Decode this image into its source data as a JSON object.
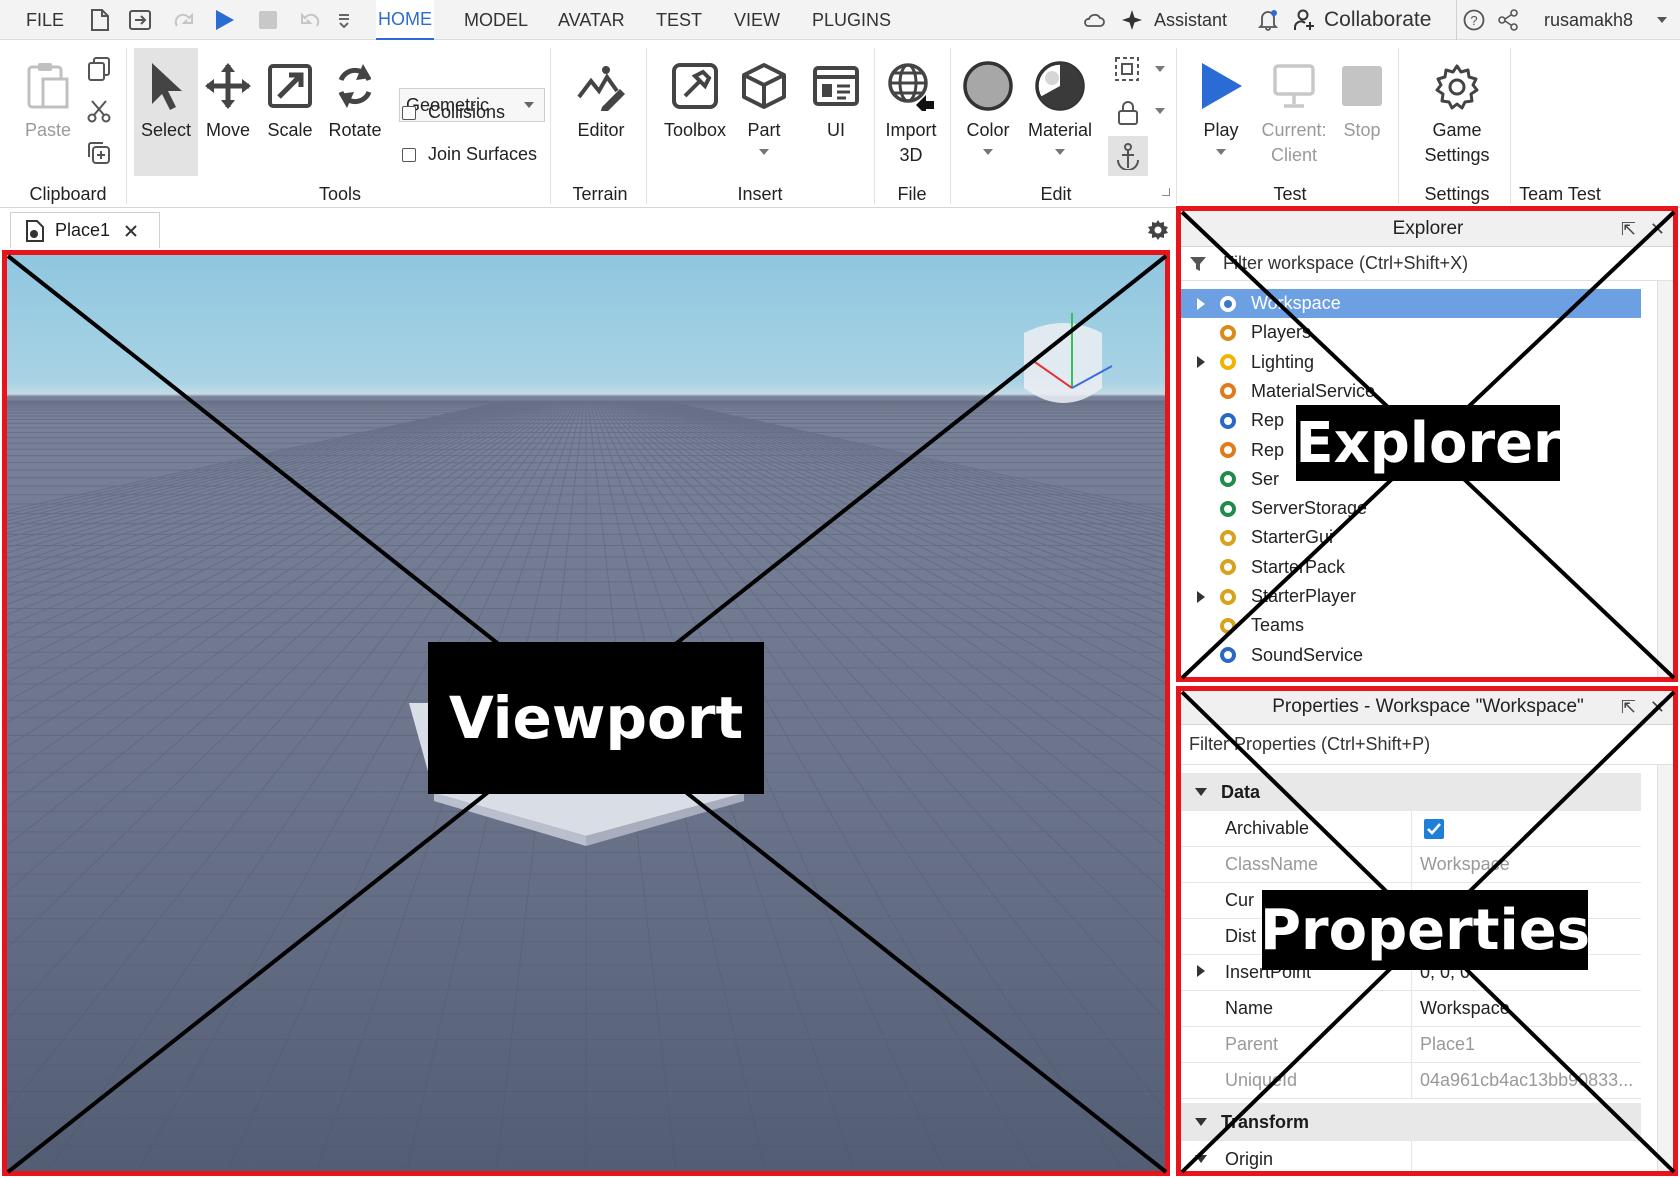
{
  "menubar": {
    "file": "FILE",
    "tabs": [
      "HOME",
      "MODEL",
      "AVATAR",
      "TEST",
      "VIEW",
      "PLUGINS"
    ],
    "assistant": "Assistant",
    "collaborate": "Collaborate",
    "username": "rusamakh8",
    "icons": [
      "new-file-icon",
      "open-icon",
      "redo-icon",
      "play-icon",
      "stop-icon",
      "undo-icon",
      "customize-icon",
      "cloud-icon",
      "sparkle-icon",
      "bell-icon",
      "add-user-icon",
      "help-icon",
      "share-icon"
    ]
  },
  "ribbon": {
    "clipboard": {
      "paste": "Paste",
      "group": "Clipboard"
    },
    "tools": {
      "select": "Select",
      "move": "Move",
      "scale": "Scale",
      "rotate": "Rotate",
      "mode": "Geometric",
      "collisions": "Collisions",
      "join_surfaces": "Join Surfaces",
      "group": "Tools"
    },
    "terrain": {
      "editor": "Editor",
      "group": "Terrain"
    },
    "insert": {
      "toolbox": "Toolbox",
      "part": "Part",
      "ui": "UI",
      "group": "Insert"
    },
    "file": {
      "import_line1": "Import",
      "import_line2": "3D",
      "group": "File"
    },
    "edit": {
      "color": "Color",
      "material": "Material",
      "group": "Edit"
    },
    "test": {
      "play": "Play",
      "current_line1": "Current:",
      "current_line2": "Client",
      "stop": "Stop",
      "group": "Test"
    },
    "settings": {
      "game_line1": "Game",
      "game_line2": "Settings",
      "group": "Settings"
    },
    "teamtest": {
      "group": "Team Test"
    }
  },
  "document_tab": {
    "label": "Place1"
  },
  "viewport": {
    "label": "Viewport"
  },
  "explorer": {
    "title": "Explorer",
    "filter_placeholder": "Filter workspace (Ctrl+Shift+X)",
    "label": "Explorer",
    "items": [
      {
        "label": "Workspace",
        "icon": "workspace-icon",
        "expandable": true,
        "selected": true
      },
      {
        "label": "Players",
        "icon": "players-icon",
        "expandable": false
      },
      {
        "label": "Lighting",
        "icon": "lighting-icon",
        "expandable": true
      },
      {
        "label": "MaterialService",
        "icon": "material-service-icon",
        "expandable": false
      },
      {
        "label": "Rep",
        "icon": "replicated-first-icon",
        "expandable": false
      },
      {
        "label": "Rep",
        "icon": "replicated-storage-icon",
        "expandable": false
      },
      {
        "label": "Ser",
        "icon": "server-script-service-icon",
        "expandable": false
      },
      {
        "label": "ServerStorage",
        "icon": "server-storage-icon",
        "expandable": false
      },
      {
        "label": "StarterGui",
        "icon": "starter-gui-icon",
        "expandable": false
      },
      {
        "label": "StarterPack",
        "icon": "starter-pack-icon",
        "expandable": false
      },
      {
        "label": "StarterPlayer",
        "icon": "starter-player-icon",
        "expandable": true
      },
      {
        "label": "Teams",
        "icon": "teams-icon",
        "expandable": false
      },
      {
        "label": "SoundService",
        "icon": "sound-service-icon",
        "expandable": false
      }
    ]
  },
  "properties": {
    "title": "Properties - Workspace \"Workspace\"",
    "filter_placeholder": "Filter Properties (Ctrl+Shift+P)",
    "label": "Properties",
    "categories": {
      "data": "Data",
      "transform": "Transform"
    },
    "rows": [
      {
        "name": "Archivable",
        "value": "",
        "checked": true,
        "readonly": false
      },
      {
        "name": "ClassName",
        "value": "Workspace",
        "readonly": true
      },
      {
        "name": "Cur",
        "value": "",
        "readonly": false
      },
      {
        "name": "Dist",
        "value": "",
        "readonly": false
      },
      {
        "name": "InsertPoint",
        "value": "0, 0, 0",
        "readonly": false,
        "expandable": true
      },
      {
        "name": "Name",
        "value": "Workspace",
        "readonly": false
      },
      {
        "name": "Parent",
        "value": "Place1",
        "readonly": true
      },
      {
        "name": "UniqueId",
        "value": "04a961cb4ac13bb90833...",
        "readonly": true
      }
    ],
    "origin": "Origin"
  },
  "colors": {
    "accent": "#2b6bd6",
    "annotation_red": "#e8141b",
    "selection": "#6d9fe3"
  }
}
